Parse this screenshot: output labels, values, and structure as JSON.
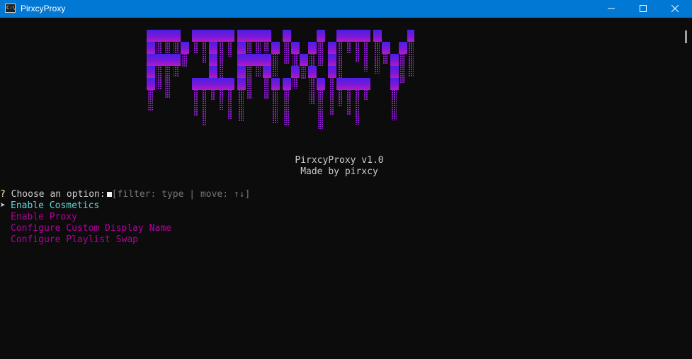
{
  "window": {
    "title": "PirxcyProxy",
    "icon": "console-app-icon",
    "icon_glyph": "C:\\"
  },
  "banner": {
    "logo_text": "PIRXCY",
    "version_line": "PirxcyProxy v1.0",
    "author_line": "Made by pirxcy",
    "colors": {
      "top": "#5a1fe0",
      "bottom": "#b418c8"
    }
  },
  "prompt": {
    "question_mark": "?",
    "label": "Choose an option:",
    "hint": "[filter: type | move: ↑↓]"
  },
  "menu": {
    "pointer": "➤",
    "items": [
      {
        "label": "Enable Cosmetics",
        "selected": true
      },
      {
        "label": "Enable Proxy",
        "selected": false
      },
      {
        "label": "Configure Custom Display Name",
        "selected": false
      },
      {
        "label": "Configure Playlist Swap",
        "selected": false
      }
    ]
  },
  "colors": {
    "titlebar": "#0078d4",
    "background": "#0c0c0c",
    "selected": "#61d6d6",
    "option": "#b4009e",
    "question": "#f9f1a5",
    "hint": "#767676"
  }
}
